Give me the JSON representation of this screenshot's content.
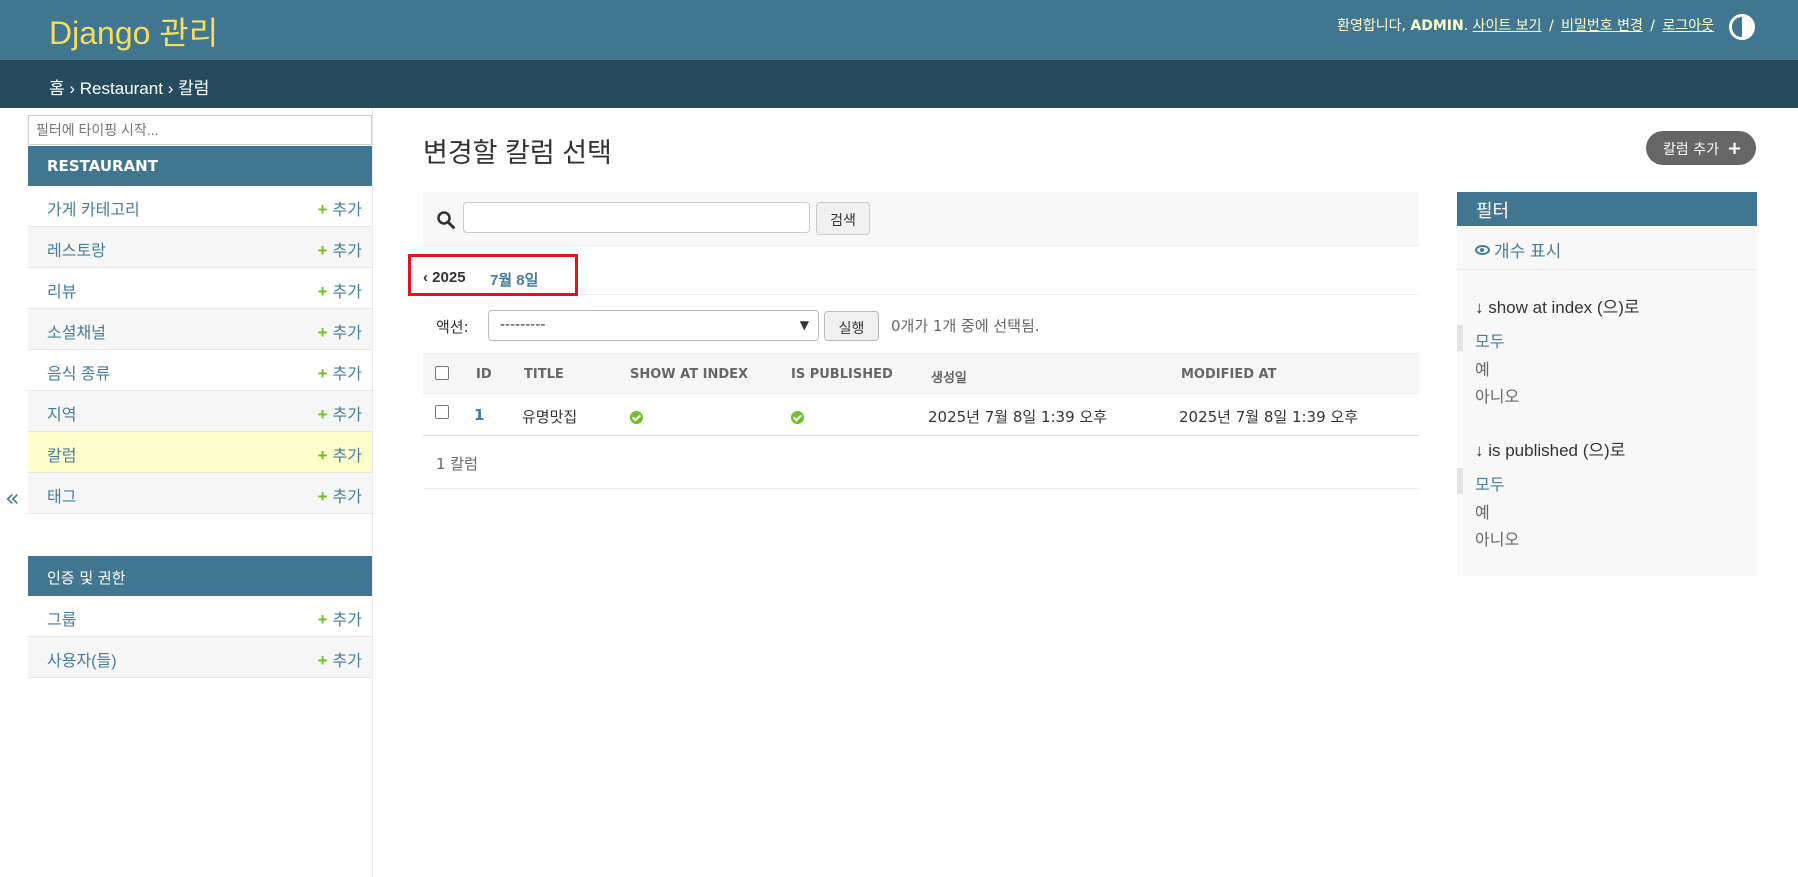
{
  "header": {
    "brand": "Django 관리",
    "welcome": "환영합니다, ",
    "username": "ADMIN",
    "view_site": "사이트 보기",
    "change_password": "비밀번호 변경",
    "logout": "로그아웃",
    "sep": "/"
  },
  "breadcrumbs": {
    "home": "홈",
    "app": "Restaurant",
    "model": "칼럼",
    "sep": "›"
  },
  "sidebar": {
    "filter_placeholder": "필터에 타이핑 시작...",
    "collapse_glyph": "«",
    "modules": [
      {
        "title": "RESTAURANT",
        "items": [
          {
            "label": "가게 카테고리",
            "add": "추가"
          },
          {
            "label": "레스토랑",
            "add": "추가"
          },
          {
            "label": "리뷰",
            "add": "추가"
          },
          {
            "label": "소셜채널",
            "add": "추가"
          },
          {
            "label": "음식 종류",
            "add": "추가"
          },
          {
            "label": "지역",
            "add": "추가"
          },
          {
            "label": "칼럼",
            "add": "추가"
          },
          {
            "label": "태그",
            "add": "추가"
          }
        ]
      },
      {
        "title": "인증 및 권한",
        "items": [
          {
            "label": "그룹",
            "add": "추가"
          },
          {
            "label": "사용자(들)",
            "add": "추가"
          }
        ]
      }
    ]
  },
  "main": {
    "title": "변경할 칼럼 선택",
    "add_button": "칼럼 추가",
    "search_button": "검색",
    "date_hierarchy": {
      "year": "‹ 2025",
      "day": "7월 8일"
    },
    "actions": {
      "label": "액션:",
      "selected": "---------",
      "run": "실행",
      "counter": "0개가 1개 중에 선택됨."
    },
    "columns": [
      "ID",
      "TITLE",
      "SHOW AT INDEX",
      "IS PUBLISHED",
      "생성일",
      "MODIFIED AT"
    ],
    "rows": [
      {
        "id": "1",
        "title": "유명맛집",
        "show_at_index": true,
        "is_published": true,
        "created": "2025년 7월 8일 1:39 오후",
        "modified": "2025년 7월 8일 1:39 오후"
      }
    ],
    "paginator": "1 칼럼"
  },
  "filter": {
    "title": "필터",
    "show_counts": "개수 표시",
    "groups": [
      {
        "title": "↓ show at index (으)로",
        "options": [
          "모두",
          "예",
          "아니오"
        ],
        "selected": 0
      },
      {
        "title": "↓ is published (으)로",
        "options": [
          "모두",
          "예",
          "아니오"
        ],
        "selected": 0
      }
    ]
  },
  "colors": {
    "header": "#417690",
    "breadcrumbs": "#264b5d",
    "brand": "#f5dd5d",
    "link": "#447e9b",
    "add_plus": "#70bf2b",
    "current_row": "#ffffcc",
    "highlight": "#e0141e"
  }
}
